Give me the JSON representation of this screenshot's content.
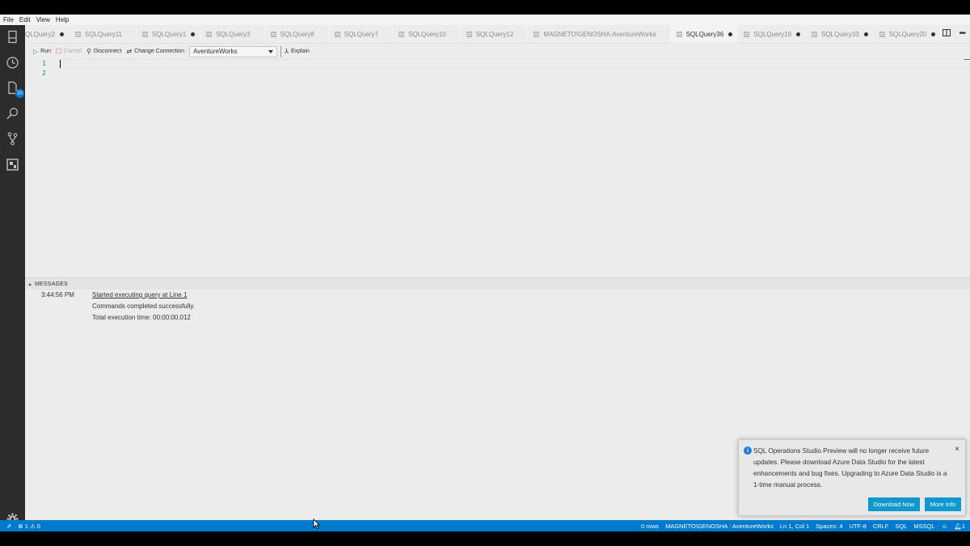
{
  "menu": [
    "File",
    "Edit",
    "View",
    "Help"
  ],
  "activity": {
    "explorer_badge": "20"
  },
  "tabs": [
    {
      "label": "QLQuery2",
      "dirty": true,
      "active": false,
      "first": true
    },
    {
      "label": "SQLQuery11",
      "dirty": false,
      "active": false
    },
    {
      "label": "SQLQuery1",
      "dirty": true,
      "active": false
    },
    {
      "label": "SQLQuery3",
      "dirty": false,
      "active": false
    },
    {
      "label": "SQLQuery8",
      "dirty": false,
      "active": false
    },
    {
      "label": "SQLQuery7",
      "dirty": false,
      "active": false
    },
    {
      "label": "SQLQuery10",
      "dirty": false,
      "active": false
    },
    {
      "label": "SQLQuery12",
      "dirty": false,
      "active": false
    },
    {
      "label": "MAGNETO\\GENOSHA:AventureWorks",
      "dirty": false,
      "active": false
    },
    {
      "label": "SQLQuery36",
      "dirty": true,
      "active": true
    },
    {
      "label": "SQLQuery19",
      "dirty": true,
      "active": false
    },
    {
      "label": "SQLQuery33",
      "dirty": true,
      "active": false
    },
    {
      "label": "SQLQuery20",
      "dirty": true,
      "active": false
    }
  ],
  "toolbar": {
    "run": "Run",
    "cancel": "Cancel",
    "disconnect": "Disconnect",
    "change_connection": "Change Connection",
    "database": "AventureWorks",
    "explain": "Explain"
  },
  "editor": {
    "line_numbers": [
      "1",
      "2"
    ]
  },
  "messages": {
    "header": "MESSAGES",
    "time": "3:44:56 PM",
    "lines": [
      "Started executing query at Line 1",
      "Commands completed successfully.",
      "Total execution time: 00:00:00.012"
    ]
  },
  "notification": {
    "text": "SQL Operations Studio Preview will no longer receive future updates. Please download Azure Data Studio for the latest enhancements and bug fixes. Upgrading to Azure Data Studio is a 1-time manual process.",
    "download_label": "Download Now",
    "more_info_label": "More Info",
    "close": "×"
  },
  "status": {
    "errors": "1",
    "warnings": "0",
    "rows": "0 rows",
    "connection": "MAGNETO\\GENOSHA : AventureWorks",
    "position": "Ln 1, Col 1",
    "spaces": "Spaces: 4",
    "encoding": "UTF-8",
    "eol": "CRLF",
    "language": "SQL",
    "provider": "MSSQL",
    "notifications": "1"
  },
  "colors": {
    "status_bar": "#007acc",
    "activity_bar": "#2c2c2c",
    "button": "#0e98cf"
  }
}
